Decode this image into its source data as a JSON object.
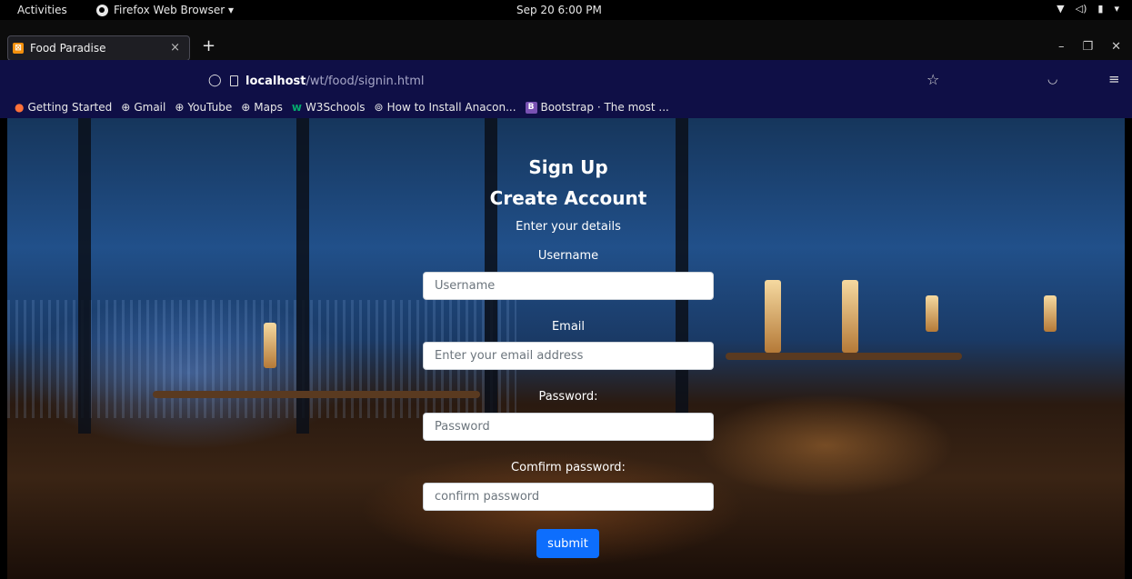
{
  "system_bar": {
    "activities": "Activities",
    "app_name": "Firefox Web Browser ▾",
    "clock": "Sep 20  6:00 PM"
  },
  "browser": {
    "tab_title": "Food Paradise",
    "tab_close": "×",
    "new_tab": "+",
    "url_host": "localhost",
    "url_path": "/wt/food/signin.html",
    "bookmarks": [
      {
        "label": "Getting Started",
        "icon": "firefox-icon"
      },
      {
        "label": "Gmail",
        "icon": "globe-icon"
      },
      {
        "label": "YouTube",
        "icon": "globe-icon"
      },
      {
        "label": "Maps",
        "icon": "globe-icon"
      },
      {
        "label": "W3Schools",
        "icon": "w3schools-icon"
      },
      {
        "label": "How to Install Anacon...",
        "icon": "site-icon"
      },
      {
        "label": "Bootstrap · The most ...",
        "icon": "bootstrap-icon"
      }
    ]
  },
  "form": {
    "title": "Sign Up",
    "subtitle": "Create Account",
    "instructions": "Enter your details",
    "username_label": "Username",
    "username_placeholder": "Username",
    "email_label": "Email",
    "email_placeholder": "Enter your email address",
    "password_label": "Password:",
    "password_placeholder": "Password",
    "confirm_label": "Comfirm password:",
    "confirm_placeholder": "confirm password",
    "submit_label": "submit"
  },
  "colors": {
    "browser_toolbar": "#0f0f46",
    "submit_button": "#0d6efd"
  }
}
